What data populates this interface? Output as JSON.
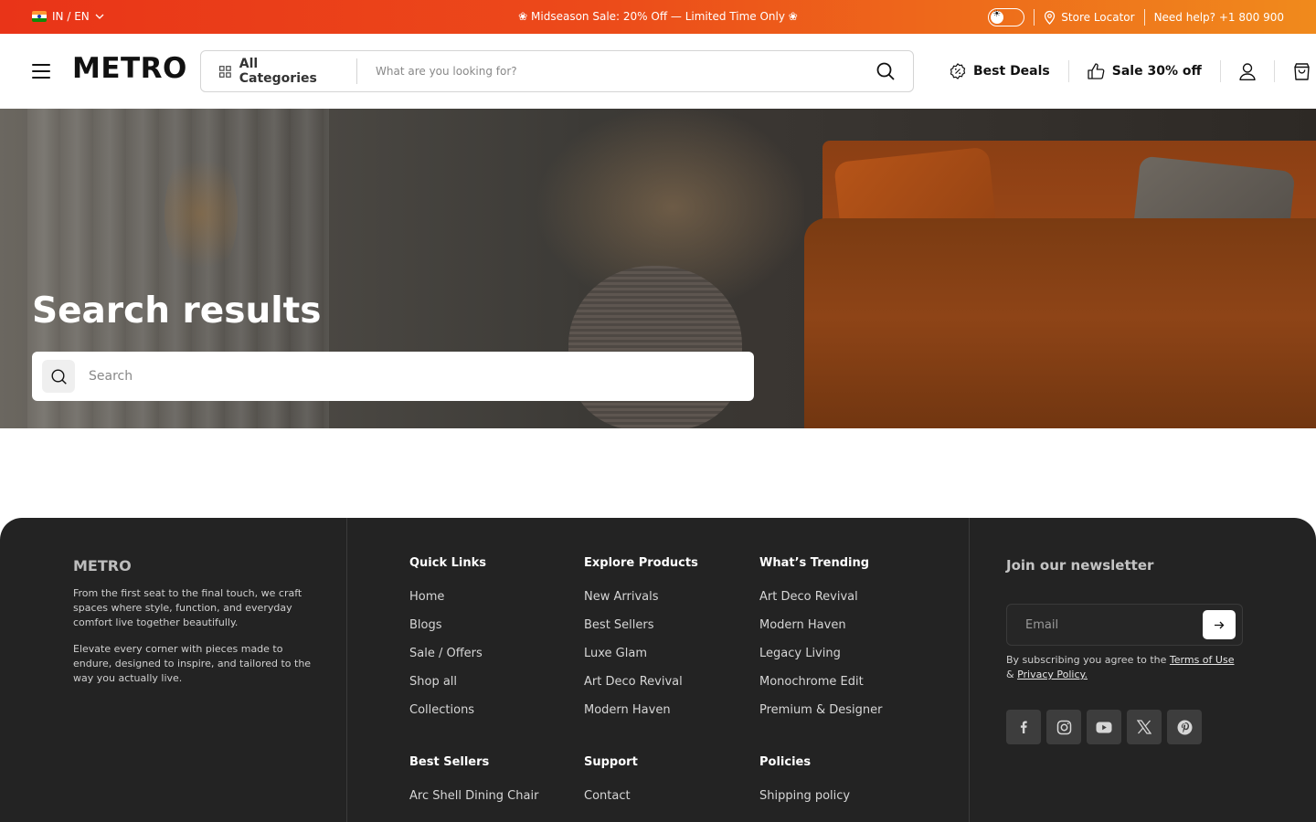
{
  "announcement": {
    "locale": "IN / EN",
    "promo": "❀ Midseason Sale: 20% Off — Limited Time Only ❀",
    "store_locator": "Store Locator",
    "help": "Need help? +1 800 900"
  },
  "header": {
    "logo": "METRO",
    "all_categories": "All Categories",
    "search_placeholder": "What are you looking for?",
    "nav": [
      {
        "label": "Best Deals",
        "icon": "discount-badge-icon"
      },
      {
        "label": "Sale 30% off",
        "icon": "thumbs-up-icon"
      }
    ]
  },
  "hero": {
    "title": "Search results",
    "search_placeholder": "Search"
  },
  "footer": {
    "brand": "METRO",
    "about": [
      "From the first seat to the final touch, we craft spaces where style, function, and everyday comfort live together beautifully.",
      "Elevate every corner with pieces made to endure, designed to inspire, and tailored to the way you actually live."
    ],
    "columns": [
      {
        "title": "Quick Links",
        "items": [
          "Home",
          "Blogs",
          "Sale / Offers",
          "Shop all",
          "Collections"
        ]
      },
      {
        "title": "Explore Products",
        "items": [
          "New Arrivals",
          "Best Sellers",
          "Luxe Glam",
          "Art Deco Revival",
          "Modern Haven"
        ]
      },
      {
        "title": "What’s Trending",
        "items": [
          "Art Deco Revival",
          "Modern Haven",
          "Legacy Living",
          "Monochrome Edit",
          "Premium & Designer"
        ]
      },
      {
        "title": "Best Sellers",
        "items": [
          "Arc Shell Dining Chair"
        ]
      },
      {
        "title": "Support",
        "items": [
          "Contact"
        ]
      },
      {
        "title": "Policies",
        "items": [
          "Shipping policy"
        ]
      }
    ],
    "newsletter": {
      "title": "Join our newsletter",
      "email_placeholder": "Email",
      "terms_prefix": "By subscribing you agree to the",
      "terms_link": "Terms of Use",
      "terms_and": "&",
      "privacy_link": "Privacy Policy."
    },
    "social": [
      "facebook-icon",
      "instagram-icon",
      "youtube-icon",
      "x-icon",
      "pinterest-icon"
    ]
  }
}
